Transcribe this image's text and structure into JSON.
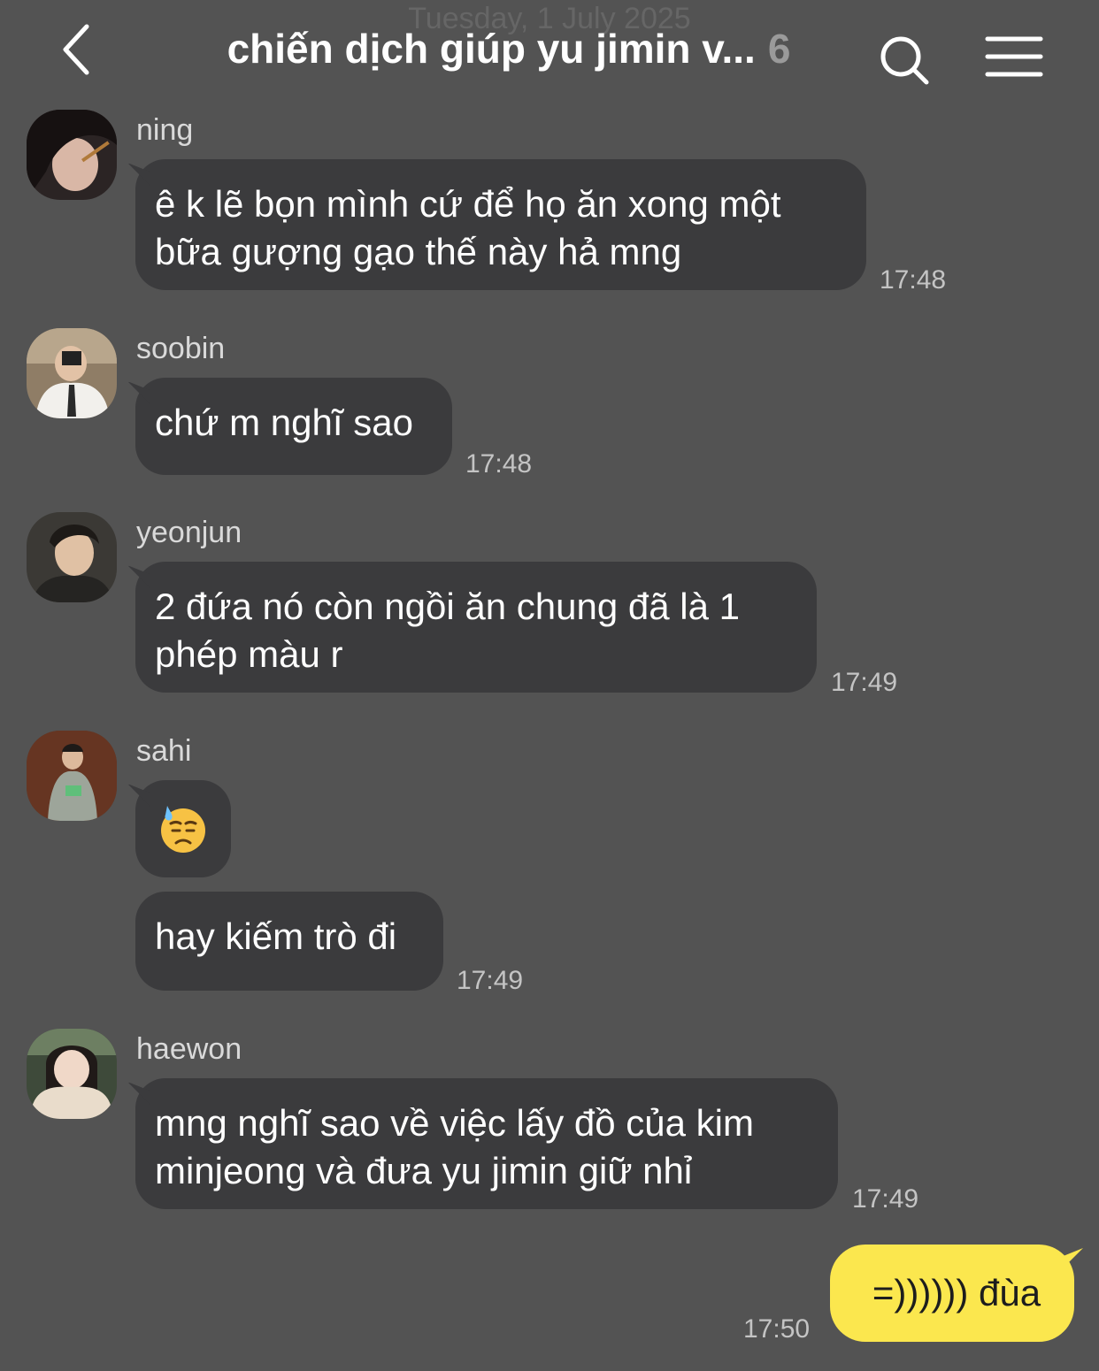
{
  "header": {
    "date_ghost": "Tuesday, 1 July 2025",
    "title": "chiến dịch giúp yu jimin v...",
    "member_count": "6"
  },
  "messages": [
    {
      "sender": "ning",
      "text_lines": [
        "ê k lẽ bọn mình cứ để họ ăn xong một",
        "bữa gượng gạo thế này hả mng"
      ],
      "time": "17:48"
    },
    {
      "sender": "soobin",
      "text": "chứ m nghĩ sao",
      "time": "17:48"
    },
    {
      "sender": "yeonjun",
      "text_lines": [
        "2 đứa nó còn ngồi ăn chung đã là 1",
        "phép màu r"
      ],
      "time": "17:49"
    },
    {
      "sender": "sahi",
      "emoji": "downcast-face-with-sweat",
      "text": "hay kiếm trò đi",
      "time": "17:49"
    },
    {
      "sender": "haewon",
      "text_lines": [
        "mng nghĩ sao về việc lấy đồ của kim",
        "minjeong và đưa yu jimin giữ nhỉ"
      ],
      "time": "17:49"
    }
  ],
  "my_message": {
    "text": "=)))))) đùa",
    "time": "17:50"
  },
  "colors": {
    "background": "#535353",
    "bubble": "#3b3b3d",
    "my_bubble": "#fbe74e"
  }
}
